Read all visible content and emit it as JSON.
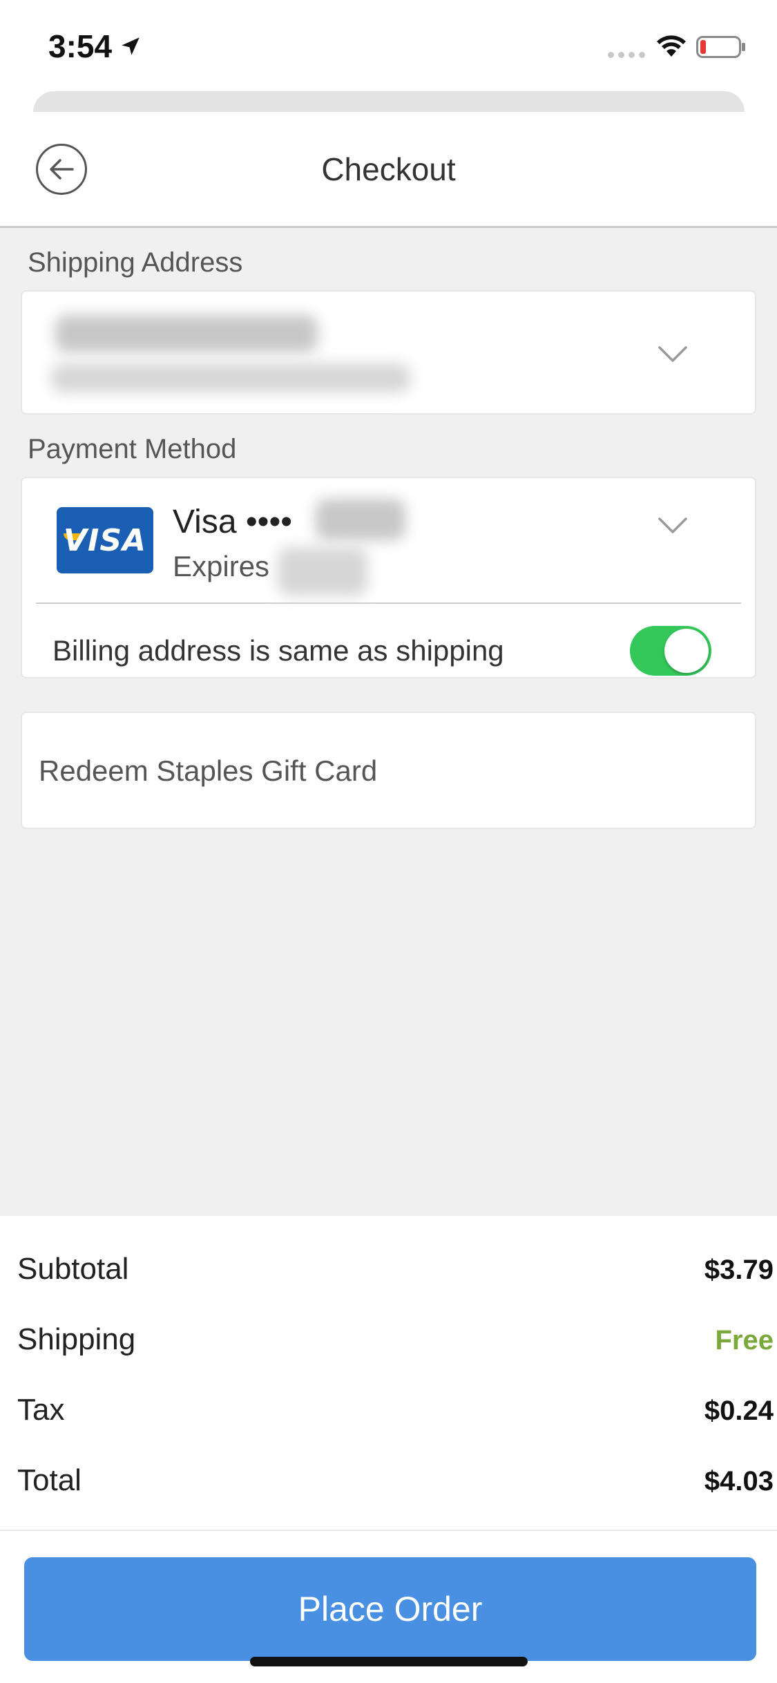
{
  "status": {
    "time": "3:54"
  },
  "nav": {
    "title": "Checkout"
  },
  "shipping": {
    "section_label": "Shipping Address"
  },
  "payment": {
    "section_label": "Payment Method",
    "card_brand_logo": "VISA",
    "card_name": "Visa ••••",
    "expires_label": "Expires",
    "billing_same_label": "Billing address is same as shipping",
    "billing_same_enabled": true
  },
  "gift_card": {
    "label": "Redeem Staples Gift Card"
  },
  "summary": {
    "rows": [
      {
        "label": "Subtotal",
        "value": "$3.79"
      },
      {
        "label": "Shipping",
        "value": "Free"
      },
      {
        "label": "Tax",
        "value": "$0.24"
      },
      {
        "label": "Total",
        "value": "$4.03"
      }
    ]
  },
  "actions": {
    "place_order": "Place Order"
  },
  "colors": {
    "accent": "#4a90e2",
    "toggle_on": "#34c759",
    "free_text": "#7aa83a",
    "background": "#f0f0f0"
  },
  "icons": [
    "location-arrow-icon",
    "wifi-icon",
    "battery-icon",
    "back-arrow-icon",
    "chevron-down-icon"
  ]
}
